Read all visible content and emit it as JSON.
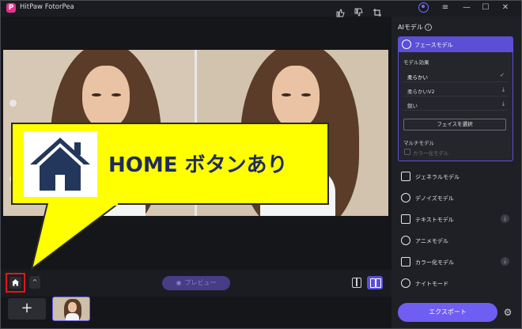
{
  "titlebar": {
    "logo_letter": "P",
    "app_title": "HitPaw FotorPea",
    "controls": {
      "menu": "≡",
      "minimize": "—",
      "maximize": "☐",
      "close": "✕"
    }
  },
  "toolbar": {
    "icons": [
      "thumbs-up-icon",
      "thumbs-down-icon",
      "crop-icon"
    ]
  },
  "callout": {
    "text": "HOME ボタンあり",
    "colors": {
      "background": "#ffff00",
      "text": "#1f2a5c",
      "highlight_box": "#e01717"
    }
  },
  "bottombar": {
    "chevron": "^",
    "preview_label": "プレビュー"
  },
  "thumbnails": {
    "add_label": "+"
  },
  "right_panel": {
    "title": "AIモデル",
    "info": "i",
    "face_model": {
      "label": "フェースモデル",
      "effect_label": "モデル効果",
      "options": [
        {
          "label": "柔らかい",
          "selected": true,
          "icon": "✓"
        },
        {
          "label": "柔らかいV2",
          "selected": false,
          "icon": "⤓"
        },
        {
          "label": "鋭い",
          "selected": false,
          "icon": "⤓"
        }
      ],
      "select_face_button": "フェイスを選択",
      "multi_label": "マルチモデル",
      "multi_checkbox_label": "カラー化モデル"
    },
    "models": [
      {
        "label": "ジェネラルモデル",
        "download": ""
      },
      {
        "label": "デノイズモデル",
        "download": ""
      },
      {
        "label": "テキストモデル",
        "download": "⤓"
      },
      {
        "label": "アニメモデル",
        "download": ""
      },
      {
        "label": "カラー化モデル",
        "download": "⤓"
      },
      {
        "label": "ナイトモード",
        "download": ""
      }
    ],
    "export_label": "エクスポート"
  },
  "colors": {
    "accent": "#6e5ef2",
    "accent_dark": "#5b4fd6",
    "bg": "#1b1c21",
    "panel": "#1f2025"
  }
}
